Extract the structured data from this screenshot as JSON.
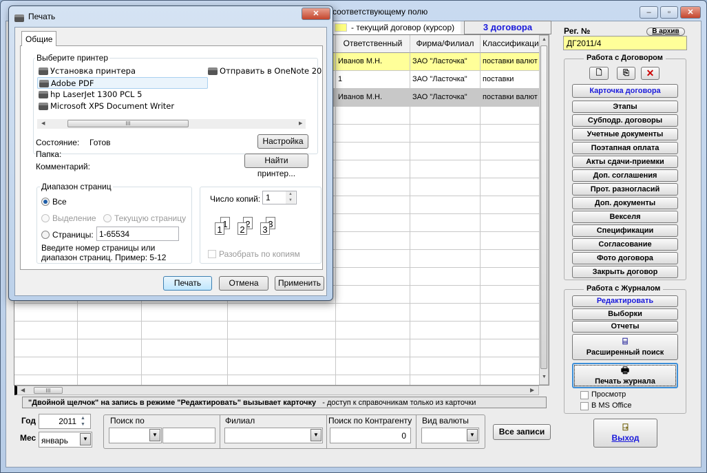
{
  "window": {
    "title_fragment": "соответствующему полю",
    "controls": {
      "minimize": "‒",
      "maximize": "▫",
      "close": "✕"
    }
  },
  "legend": {
    "cursor_label": "- текущий договор (курсор)",
    "cursor_color": "#ffff80",
    "count": "3 договора"
  },
  "grid": {
    "headers": [
      "",
      "",
      "",
      "",
      "Ответственный",
      "Фирма/Филиал",
      "Классификаци"
    ],
    "rows": [
      {
        "cells": [
          "",
          "",
          "",
          "",
          "Иванов М.Н.",
          "ЗАО \"Ласточка\"",
          "поставки валют"
        ],
        "bg": "#ffff99"
      },
      {
        "cells": [
          "",
          "",
          "",
          "",
          "1",
          "ЗАО \"Ласточка\"",
          "поставки"
        ],
        "bg": "#ffffff"
      },
      {
        "cells": [
          "",
          "",
          "",
          "",
          "Иванов М.Н.",
          "ЗАО \"Ласточка\"",
          "поставки валют"
        ],
        "bg": "#c8c8c8"
      }
    ],
    "hscroll_thumb": "III"
  },
  "hint": {
    "bold": "\"Двойной щелчок\" на запись в режиме \"Редактировать\" вызывает карточку",
    "normal": "- доступ к справочникам только из карточки"
  },
  "filters": {
    "year_label": "Год",
    "year": "2011",
    "month_label": "Мес",
    "month": "январь",
    "search_by_label": "Поиск по",
    "search_by_value": "",
    "search_text": "",
    "branch_label": "Филиал",
    "branch": "",
    "counterparty_label": "Поиск по Контрагенту",
    "counterparty": "0",
    "currency_label": "Вид валюты",
    "currency": "",
    "all_records": "Все записи"
  },
  "right": {
    "reg_label": "Рег. №",
    "archive": "В архив",
    "reg_value": "ДГ2011/4",
    "contract_group": "Работа с Договором",
    "contract_card": "Карточка договора",
    "contract_buttons": [
      "Этапы",
      "Субподр. договоры",
      "Учетные документы",
      "Поэтапная оплата",
      "Акты сдачи-приемки",
      "Доп. соглашения",
      "Прот. разногласий",
      "Доп. документы",
      "Векселя",
      "Спецификации",
      "Согласование",
      "Фото договора",
      "Закрыть договор"
    ],
    "journal_group": "Работа с Журналом",
    "edit": "Редактировать",
    "selections": "Выборки",
    "reports": "Отчеты",
    "advanced_search": "Расширенный поиск",
    "print_journal": "Печать журнала",
    "preview": "Просмотр",
    "ms_office": "В MS Office",
    "exit": "Выход"
  },
  "dialog": {
    "title": "Печать",
    "tab": "Общие",
    "printer_group": "Выберите принтер",
    "printers": [
      "Установка принтера",
      "Adobe PDF",
      "hp LaserJet 1300 PCL 5",
      "Microsoft XPS Document Writer",
      "Отправить в OneNote 20"
    ],
    "selected_printer": "Adobe PDF",
    "status_label": "Состояние:",
    "status": "Готов",
    "folder_label": "Папка:",
    "comment_label": "Комментарий:",
    "setup": "Настройка",
    "find_printer": "Найти принтер...",
    "range_group": "Диапазон страниц",
    "all": "Все",
    "selection": "Выделение",
    "current_page": "Текущую страницу",
    "pages_label": "Страницы:",
    "pages_value": "1-65534",
    "range_hint": "Введите номер страницы или диапазон страниц.  Пример: 5-12",
    "copies_label": "Число копий:",
    "copies": "1",
    "collate": "Разобрать по копиям",
    "collate_pages": [
      "1",
      "1",
      "2",
      "2",
      "3",
      "3"
    ],
    "print": "Печать",
    "cancel": "Отмена",
    "apply": "Применить",
    "close": "✕",
    "scroll_thumb": "III"
  }
}
